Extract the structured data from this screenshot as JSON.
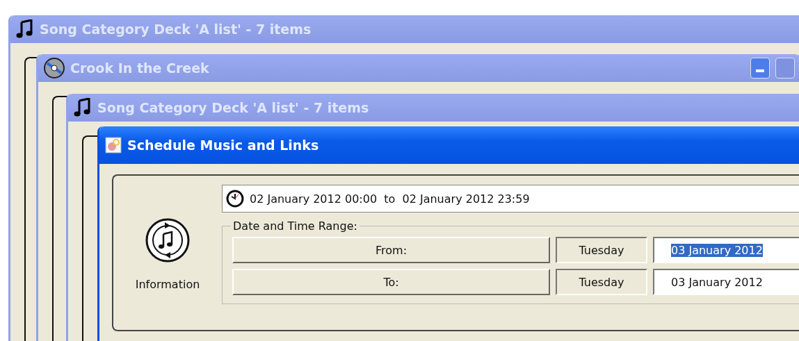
{
  "windows": [
    {
      "title": "Song Category Deck 'A list' - 7 items",
      "kind": "deck",
      "active": false,
      "controls": false
    },
    {
      "title": "Crook In the Creek",
      "kind": "song",
      "active": false,
      "controls": true
    },
    {
      "title": "Song Category Deck 'A list' - 7 items",
      "kind": "deck",
      "active": false,
      "controls": false
    }
  ],
  "dialog": {
    "title": "Schedule Music and Links",
    "active": true,
    "side": {
      "label": "Information"
    },
    "summary": "02 January 2012 00:00  to  02 January 2012 23:59",
    "group": {
      "label": "Date and Time Range:",
      "rows": [
        {
          "button": "From:",
          "day": "Tuesday",
          "date": "03 January 2012",
          "selected": true
        },
        {
          "button": "To:",
          "day": "Tuesday",
          "date": "03 January 2012",
          "selected": false
        }
      ]
    }
  }
}
